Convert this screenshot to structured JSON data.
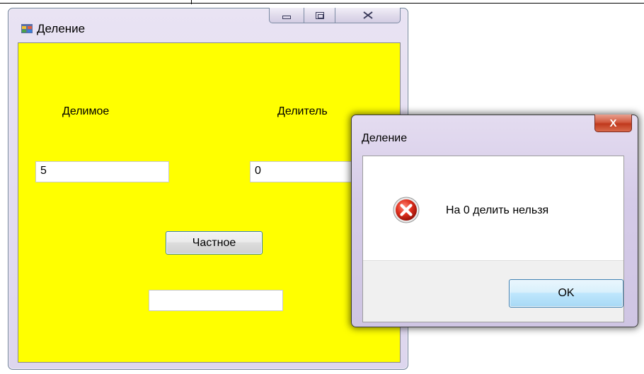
{
  "main_window": {
    "title": "Деление",
    "labels": {
      "dividend": "Делимое",
      "divisor": "Делитель"
    },
    "inputs": {
      "dividend_value": "5",
      "divisor_value": "0",
      "result_value": ""
    },
    "quotient_button": "Частное",
    "colors": {
      "client_background": "#ffff00"
    },
    "caption_icons": [
      "minimize-icon",
      "maximize-icon",
      "close-icon"
    ]
  },
  "message_box": {
    "title": "Деление",
    "close_glyph": "X",
    "message": "На 0 делить нельзя",
    "icon": "error-icon",
    "ok_button": "OK"
  }
}
